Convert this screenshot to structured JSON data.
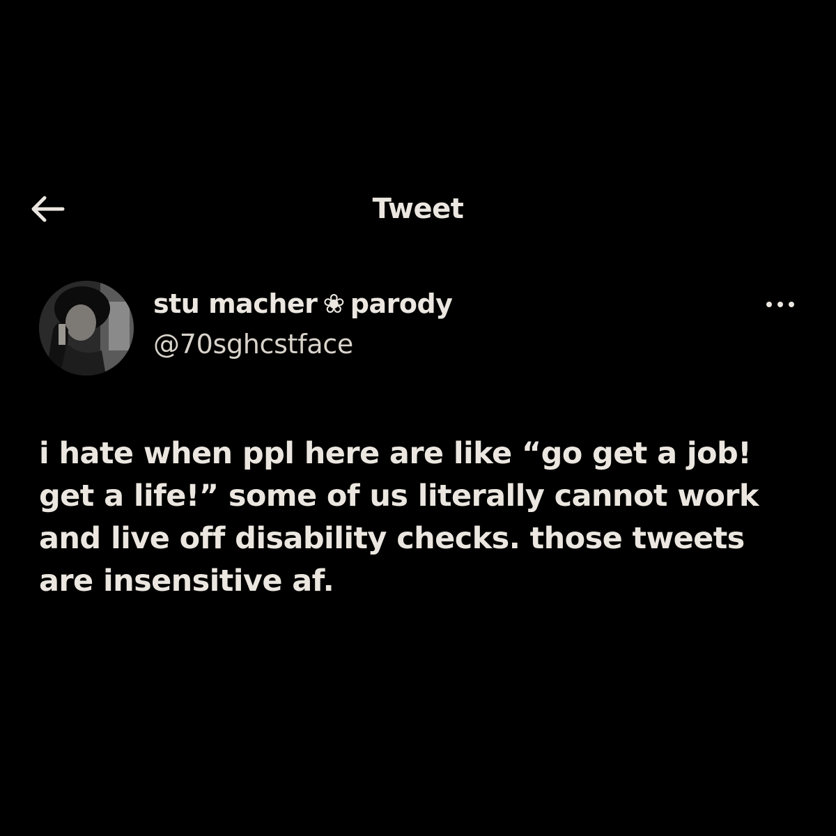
{
  "header": {
    "title": "Tweet",
    "back_icon": "arrow-left-icon"
  },
  "tweet": {
    "author": {
      "name": "stu macher",
      "name_symbol": "❀",
      "name_suffix": "parody",
      "handle": "@70sghcstface"
    },
    "more_icon": "more-horizontal-icon",
    "text": "i hate when ppl here are like “go get a job! get a life!” some of us literally cannot work and live off disability checks. those tweets are insensitive af."
  },
  "colors": {
    "background": "#000000",
    "text": "#ebe7e0",
    "secondary_text": "#d8d3cb"
  }
}
